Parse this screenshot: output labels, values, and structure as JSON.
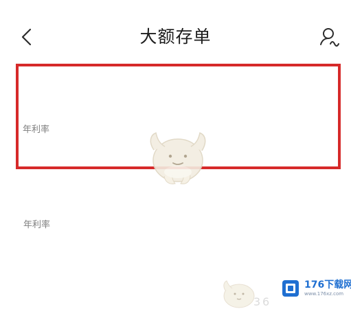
{
  "header": {
    "title": "大额存单",
    "back_icon": "chevron-left-icon",
    "user_icon": "user-service-icon"
  },
  "products": [
    {
      "rate_label": "年利率"
    },
    {
      "rate_label": "年利率"
    }
  ],
  "highlight": {
    "color": "#d62a2a"
  },
  "watermark": {
    "logo_text": "176下载网",
    "logo_subtext": "www.176xz.com",
    "brand_color": "#1f6fd1"
  }
}
